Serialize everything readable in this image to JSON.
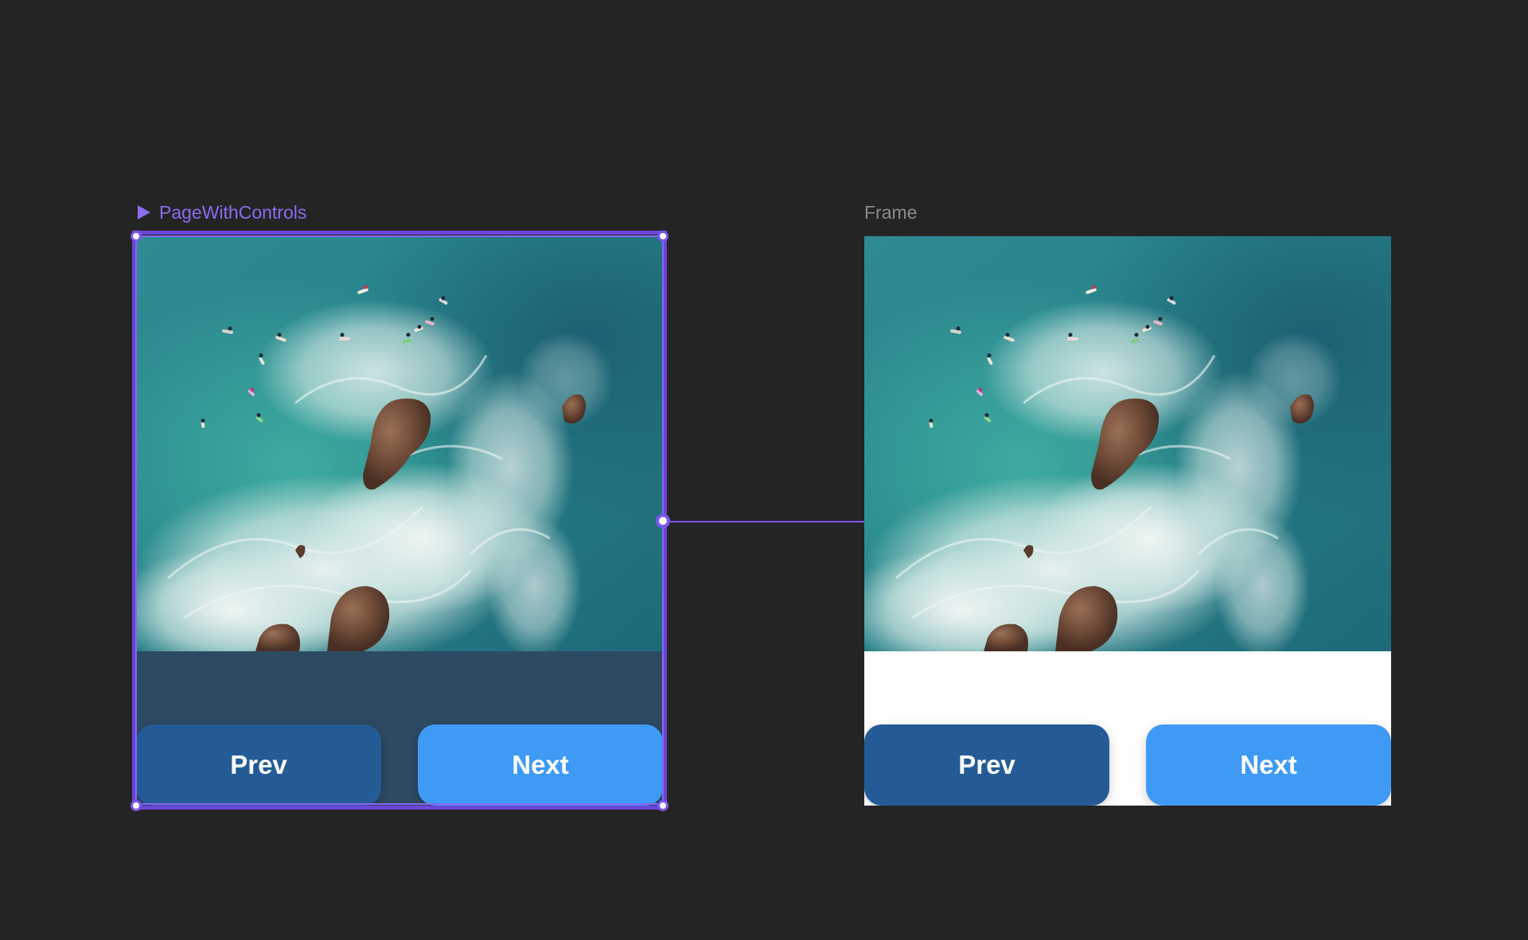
{
  "canvas": {
    "background": "#242424"
  },
  "component": {
    "label": "PageWithControls",
    "icon": "play-triangle-icon",
    "accent": "#8a6cf0",
    "background": "#2d4a63"
  },
  "frame": {
    "label": "Frame",
    "background": "#ffffff"
  },
  "controls": {
    "prev_label": "Prev",
    "next_label": "Next",
    "prev_color": "#245b96",
    "next_color": "#3f9af5"
  },
  "image": {
    "subject": "aerial ocean surf with rocks",
    "alt": "Aerial view of surfers in turquoise ocean near rocks"
  }
}
